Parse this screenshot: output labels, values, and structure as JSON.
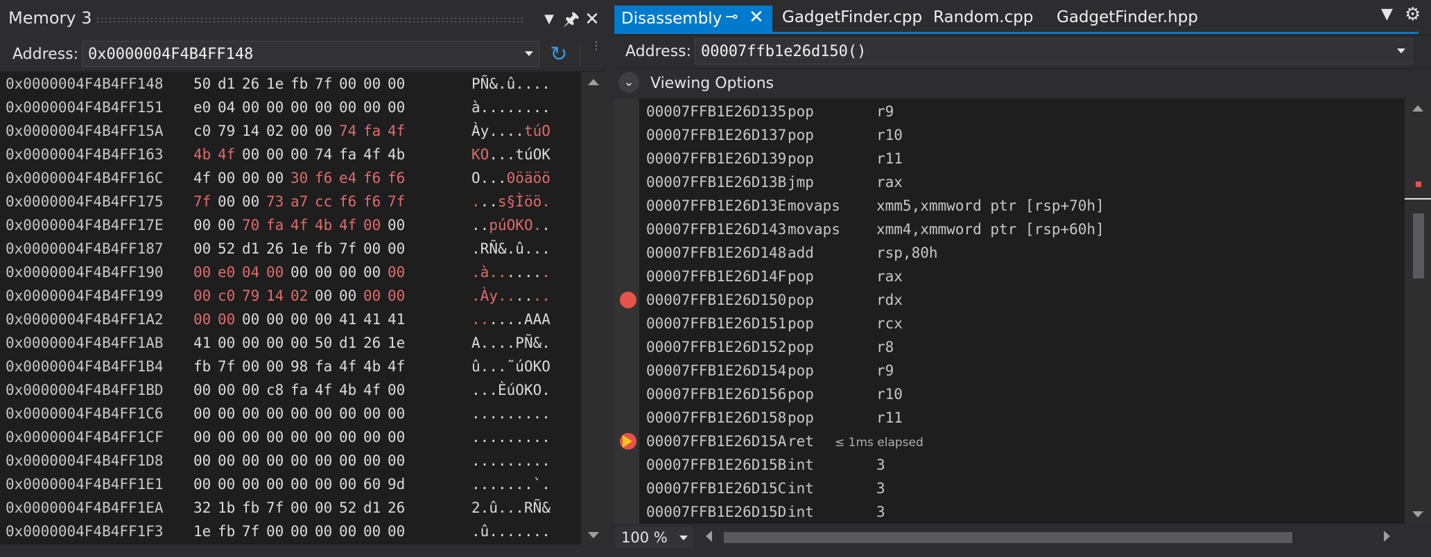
{
  "memory": {
    "title": "Memory 3",
    "address_label": "Address:",
    "address_value": "0x0000004F4B4FF148",
    "rows": [
      {
        "addr": "0x0000004F4B4FF148",
        "bytes": [
          "50",
          "d1",
          "26",
          "1e",
          "fb",
          "7f",
          "00",
          "00",
          "00"
        ],
        "changed": [],
        "ascii": "PÑ&.û....",
        "ascii_changed": []
      },
      {
        "addr": "0x0000004F4B4FF151",
        "bytes": [
          "e0",
          "04",
          "00",
          "00",
          "00",
          "00",
          "00",
          "00",
          "00"
        ],
        "changed": [],
        "ascii": "à........",
        "ascii_changed": []
      },
      {
        "addr": "0x0000004F4B4FF15A",
        "bytes": [
          "c0",
          "79",
          "14",
          "02",
          "00",
          "00",
          "74",
          "fa",
          "4f"
        ],
        "changed": [
          6,
          7,
          8
        ],
        "ascii": "Ày....túO",
        "ascii_changed": [
          6,
          7,
          8
        ]
      },
      {
        "addr": "0x0000004F4B4FF163",
        "bytes": [
          "4b",
          "4f",
          "00",
          "00",
          "00",
          "74",
          "fa",
          "4f",
          "4b"
        ],
        "changed": [
          0,
          1
        ],
        "ascii": "KO...túOK",
        "ascii_changed": [
          0,
          1
        ]
      },
      {
        "addr": "0x0000004F4B4FF16C",
        "bytes": [
          "4f",
          "00",
          "00",
          "00",
          "30",
          "f6",
          "e4",
          "f6",
          "f6"
        ],
        "changed": [
          4,
          5,
          6,
          7,
          8
        ],
        "ascii": "O...0öäöö",
        "ascii_changed": [
          4,
          5,
          6,
          7,
          8
        ]
      },
      {
        "addr": "0x0000004F4B4FF175",
        "bytes": [
          "7f",
          "00",
          "00",
          "73",
          "a7",
          "cc",
          "f6",
          "f6",
          "7f"
        ],
        "changed": [
          0,
          3,
          4,
          5,
          6,
          7,
          8
        ],
        "ascii": "...s§Ìöö.",
        "ascii_changed": [
          0,
          3,
          4,
          5,
          6,
          7,
          8
        ]
      },
      {
        "addr": "0x0000004F4B4FF17E",
        "bytes": [
          "00",
          "00",
          "70",
          "fa",
          "4f",
          "4b",
          "4f",
          "00",
          "00"
        ],
        "changed": [
          2,
          3,
          4,
          5,
          6,
          7
        ],
        "ascii": "..púOKO..",
        "ascii_changed": [
          2,
          3,
          4,
          5,
          6,
          7
        ]
      },
      {
        "addr": "0x0000004F4B4FF187",
        "bytes": [
          "00",
          "52",
          "d1",
          "26",
          "1e",
          "fb",
          "7f",
          "00",
          "00"
        ],
        "changed": [],
        "ascii": ".RÑ&.û...",
        "ascii_changed": []
      },
      {
        "addr": "0x0000004F4B4FF190",
        "bytes": [
          "00",
          "e0",
          "04",
          "00",
          "00",
          "00",
          "00",
          "00",
          "00"
        ],
        "changed": [
          0,
          1,
          2,
          3,
          8
        ],
        "ascii": ".à.......",
        "ascii_changed": [
          0,
          1,
          2,
          3,
          8
        ]
      },
      {
        "addr": "0x0000004F4B4FF199",
        "bytes": [
          "00",
          "c0",
          "79",
          "14",
          "02",
          "00",
          "00",
          "00",
          "00"
        ],
        "changed": [
          0,
          1,
          2,
          3,
          4,
          7,
          8
        ],
        "ascii": ".Ày......",
        "ascii_changed": [
          0,
          1,
          2,
          3,
          4,
          7,
          8
        ]
      },
      {
        "addr": "0x0000004F4B4FF1A2",
        "bytes": [
          "00",
          "00",
          "00",
          "00",
          "00",
          "00",
          "41",
          "41",
          "41"
        ],
        "changed": [
          0,
          1
        ],
        "ascii": "......AAA",
        "ascii_changed": [
          0,
          1
        ]
      },
      {
        "addr": "0x0000004F4B4FF1AB",
        "bytes": [
          "41",
          "00",
          "00",
          "00",
          "00",
          "50",
          "d1",
          "26",
          "1e"
        ],
        "changed": [],
        "ascii": "A....PÑ&.",
        "ascii_changed": []
      },
      {
        "addr": "0x0000004F4B4FF1B4",
        "bytes": [
          "fb",
          "7f",
          "00",
          "00",
          "98",
          "fa",
          "4f",
          "4b",
          "4f"
        ],
        "changed": [],
        "ascii": "û...˜úOKO",
        "ascii_changed": []
      },
      {
        "addr": "0x0000004F4B4FF1BD",
        "bytes": [
          "00",
          "00",
          "00",
          "c8",
          "fa",
          "4f",
          "4b",
          "4f",
          "00"
        ],
        "changed": [],
        "ascii": "...ÈúOKO.",
        "ascii_changed": []
      },
      {
        "addr": "0x0000004F4B4FF1C6",
        "bytes": [
          "00",
          "00",
          "00",
          "00",
          "00",
          "00",
          "00",
          "00",
          "00"
        ],
        "changed": [],
        "ascii": ".........",
        "ascii_changed": []
      },
      {
        "addr": "0x0000004F4B4FF1CF",
        "bytes": [
          "00",
          "00",
          "00",
          "00",
          "00",
          "00",
          "00",
          "00",
          "00"
        ],
        "changed": [],
        "ascii": ".........",
        "ascii_changed": []
      },
      {
        "addr": "0x0000004F4B4FF1D8",
        "bytes": [
          "00",
          "00",
          "00",
          "00",
          "00",
          "00",
          "00",
          "00",
          "00"
        ],
        "changed": [],
        "ascii": ".........",
        "ascii_changed": []
      },
      {
        "addr": "0x0000004F4B4FF1E1",
        "bytes": [
          "00",
          "00",
          "00",
          "00",
          "00",
          "00",
          "00",
          "60",
          "9d"
        ],
        "changed": [],
        "ascii": ".......`.",
        "ascii_changed": []
      },
      {
        "addr": "0x0000004F4B4FF1EA",
        "bytes": [
          "32",
          "1b",
          "fb",
          "7f",
          "00",
          "00",
          "52",
          "d1",
          "26"
        ],
        "changed": [],
        "ascii": "2.û...RÑ&",
        "ascii_changed": []
      },
      {
        "addr": "0x0000004F4B4FF1F3",
        "bytes": [
          "1e",
          "fb",
          "7f",
          "00",
          "00",
          "00",
          "00",
          "00",
          "00"
        ],
        "changed": [],
        "ascii": ".û.......",
        "ascii_changed": []
      }
    ]
  },
  "tabs": {
    "active": "Disassembly",
    "others": [
      "GadgetFinder.cpp",
      "Random.cpp",
      "GadgetFinder.hpp"
    ]
  },
  "disassembly": {
    "address_label": "Address:",
    "address_value": "00007ffb1e26d150()",
    "viewing_options": "Viewing Options",
    "zoom": "100 %",
    "rows": [
      {
        "addr": "00007FFB1E26D135",
        "mnemonic": "pop",
        "operand": "r9",
        "marker": ""
      },
      {
        "addr": "00007FFB1E26D137",
        "mnemonic": "pop",
        "operand": "r10",
        "marker": ""
      },
      {
        "addr": "00007FFB1E26D139",
        "mnemonic": "pop",
        "operand": "r11",
        "marker": ""
      },
      {
        "addr": "00007FFB1E26D13B",
        "mnemonic": "jmp",
        "operand": "rax",
        "marker": ""
      },
      {
        "addr": "00007FFB1E26D13E",
        "mnemonic": "movaps",
        "operand": "xmm5,xmmword ptr [rsp+70h]",
        "marker": ""
      },
      {
        "addr": "00007FFB1E26D143",
        "mnemonic": "movaps",
        "operand": "xmm4,xmmword ptr [rsp+60h]",
        "marker": ""
      },
      {
        "addr": "00007FFB1E26D148",
        "mnemonic": "add",
        "operand": "rsp,80h",
        "marker": ""
      },
      {
        "addr": "00007FFB1E26D14F",
        "mnemonic": "pop",
        "operand": "rax",
        "marker": ""
      },
      {
        "addr": "00007FFB1E26D150",
        "mnemonic": "pop",
        "operand": "rdx",
        "marker": "breakpoint"
      },
      {
        "addr": "00007FFB1E26D151",
        "mnemonic": "pop",
        "operand": "rcx",
        "marker": ""
      },
      {
        "addr": "00007FFB1E26D152",
        "mnemonic": "pop",
        "operand": "r8",
        "marker": ""
      },
      {
        "addr": "00007FFB1E26D154",
        "mnemonic": "pop",
        "operand": "r9",
        "marker": ""
      },
      {
        "addr": "00007FFB1E26D156",
        "mnemonic": "pop",
        "operand": "r10",
        "marker": ""
      },
      {
        "addr": "00007FFB1E26D158",
        "mnemonic": "pop",
        "operand": "r11",
        "marker": ""
      },
      {
        "addr": "00007FFB1E26D15A",
        "mnemonic": "ret",
        "operand": "",
        "marker": "current",
        "note": "≤ 1ms elapsed"
      },
      {
        "addr": "00007FFB1E26D15B",
        "mnemonic": "int",
        "operand": "3",
        "marker": ""
      },
      {
        "addr": "00007FFB1E26D15C",
        "mnemonic": "int",
        "operand": "3",
        "marker": ""
      },
      {
        "addr": "00007FFB1E26D15D",
        "mnemonic": "int",
        "operand": "3",
        "marker": ""
      }
    ]
  },
  "colors": {
    "accent": "#007acc",
    "changed_byte": "#e06c6c",
    "breakpoint": "#e5534b",
    "instruction_pointer": "#f5c518"
  },
  "icons": [
    "dropdown-icon",
    "pin-icon",
    "close-icon",
    "refresh-icon",
    "chevron-down-icon",
    "breakpoint-icon",
    "instruction-pointer-icon",
    "gear-icon",
    "menu-icon"
  ]
}
